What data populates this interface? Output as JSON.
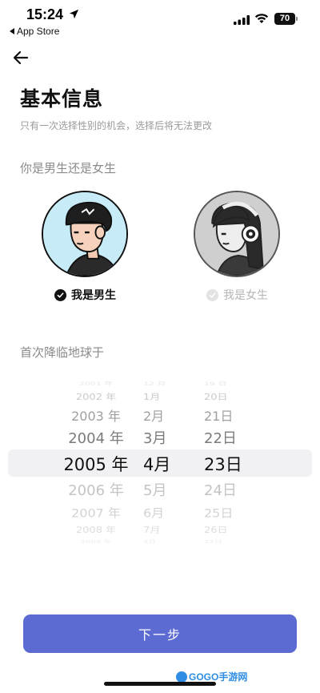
{
  "status_bar": {
    "time": "15:24",
    "back_to_app": "App Store",
    "battery": "70"
  },
  "header": {
    "back_icon": "arrow-left-icon"
  },
  "page": {
    "title": "基本信息",
    "subtitle": "只有一次选择性别的机会，选择后将无法更改",
    "gender_question": "你是男生还是女生",
    "birth_question": "首次降临地球于"
  },
  "gender": {
    "selected": "male",
    "male_label": "我是男生",
    "female_label": "我是女生"
  },
  "date_picker": {
    "years": [
      "2001 年",
      "2002 年",
      "2003 年",
      "2004 年",
      "2005 年",
      "2006 年",
      "2007 年",
      "2008 年",
      "2009 年"
    ],
    "months": [
      "12 月",
      "1月",
      "2月",
      "3月",
      "4月",
      "5月",
      "6月",
      "7月",
      "8月"
    ],
    "days": [
      "19 日",
      "20日",
      "21日",
      "22日",
      "23日",
      "24日",
      "25日",
      "26日",
      "27日"
    ],
    "selected": {
      "year": "2005 年",
      "month": "4月",
      "day": "23日"
    }
  },
  "actions": {
    "next_label": "下一步"
  },
  "watermark": {
    "text": "GOGO手游网"
  },
  "colors": {
    "accent": "#5b6bd2",
    "male_bg": "#c7ecf7",
    "female_bg": "#cfcfcf"
  }
}
